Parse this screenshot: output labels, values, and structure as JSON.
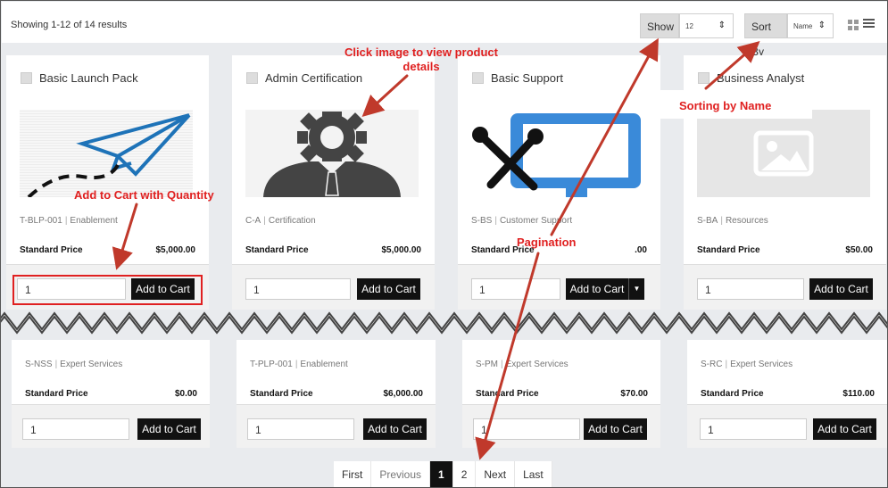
{
  "toolbar": {
    "result_count": "Showing 1-12 of 14 results",
    "show_label": "Show",
    "show_value": "12",
    "sort_label": "Sort By",
    "sort_value": "Name"
  },
  "products_top": [
    {
      "title": "Basic Launch Pack",
      "sku": "T-BLP-001",
      "category": "Enablement",
      "price_label": "Standard Price",
      "price": "$5,000.00",
      "qty": "1",
      "button": "Add to Cart"
    },
    {
      "title": "Admin Certification",
      "sku": "C-A",
      "category": "Certification",
      "price_label": "Standard Price",
      "price": "$5,000.00",
      "qty": "1",
      "button": "Add to Cart"
    },
    {
      "title": "Basic Support",
      "sku": "S-BS",
      "category": "Customer Support",
      "price_label": "Standard Price",
      "price": ".00",
      "qty": "1",
      "button": "Add to Cart"
    },
    {
      "title": "Business Analyst",
      "sku": "S-BA",
      "category": "Resources",
      "price_label": "Standard Price",
      "price": "$50.00",
      "qty": "1",
      "button": "Add to Cart"
    }
  ],
  "products_bottom": [
    {
      "sku": "S-NSS",
      "category": "Expert Services",
      "price_label": "Standard Price",
      "price": "$0.00",
      "qty": "1",
      "button": "Add to Cart"
    },
    {
      "sku": "T-PLP-001",
      "category": "Enablement",
      "price_label": "Standard Price",
      "price": "$6,000.00",
      "qty": "1",
      "button": "Add to Cart"
    },
    {
      "sku": "S-PM",
      "category": "Expert Services",
      "price_label": "Standard Price",
      "price": "$70.00",
      "qty": "1",
      "button": "Add to Cart"
    },
    {
      "sku": "S-RC",
      "category": "Expert Services",
      "price_label": "Standard Price",
      "price": "$110.00",
      "qty": "1",
      "button": "Add to Cart"
    }
  ],
  "separator": "|",
  "pagination": {
    "first": "First",
    "previous": "Previous",
    "pages": [
      "1",
      "2"
    ],
    "next": "Next",
    "last": "Last",
    "current_page": "1"
  },
  "annotations": {
    "click_image_line1": "Click image to view product",
    "click_image_line2": "details",
    "add_to_cart": "Add to Cart with Quantity",
    "sorting": "Sorting by Name",
    "pagination": "Pagination"
  },
  "colors": {
    "annotation": "#e02020",
    "button": "#111111",
    "page_background": "#e9ebee",
    "paper_plane": "#1e73b8",
    "support_monitor": "#3a8ad9"
  },
  "icons": [
    "paper-plane-icon",
    "gear-person-icon",
    "tools-monitor-icon",
    "image-placeholder-icon",
    "grid-view-icon",
    "list-view-icon"
  ]
}
